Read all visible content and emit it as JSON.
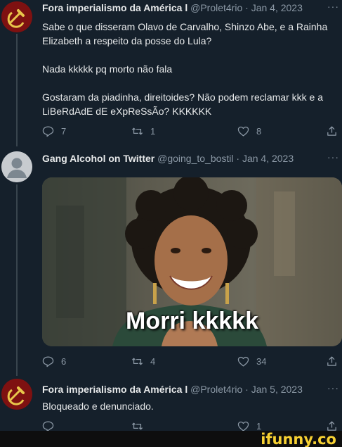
{
  "tweets": [
    {
      "display_name": "Fora imperialismo da América l",
      "handle_date": "@Prolet4rio · Jan 4, 2023",
      "more": "···",
      "lines": [
        "Sabe o que disseram Olavo de Carvalho, Shinzo Abe, e a Rainha",
        "Elizabeth a respeito da posse do Lula?",
        "Nada kkkkk pq morto não fala",
        "Gostaram da piadinha, direitoides? Não podem reclamar kkk e a",
        "LiBeRdAdE dE eXpReSsÃo? KKKKKK"
      ],
      "replies": "7",
      "retweets": "1",
      "likes": "8"
    },
    {
      "display_name": "Gang Alcohol on Twitter",
      "handle_date": "@going_to_bostil · Jan 4, 2023",
      "more": "···",
      "image_caption": "Morri kkkkk",
      "replies": "6",
      "retweets": "4",
      "likes": "34"
    },
    {
      "display_name": "Fora imperialismo da América l",
      "handle_date": "@Prolet4rio · Jan 5, 2023",
      "more": "···",
      "lines": [
        "Bloqueado e denunciado."
      ],
      "replies": "",
      "retweets": "",
      "likes": "1"
    }
  ],
  "icons": {
    "avatar_1": "hammer-sickle-avatar",
    "avatar_2": "default-user-avatar",
    "reply": "reply-icon",
    "retweet": "retweet-icon",
    "like": "heart-icon",
    "share": "share-icon"
  },
  "colors": {
    "background": "#15202b",
    "text": "#e7e9ea",
    "muted": "#8b98a5",
    "watermark": "#f7d133"
  },
  "watermark": "ifunny.co"
}
